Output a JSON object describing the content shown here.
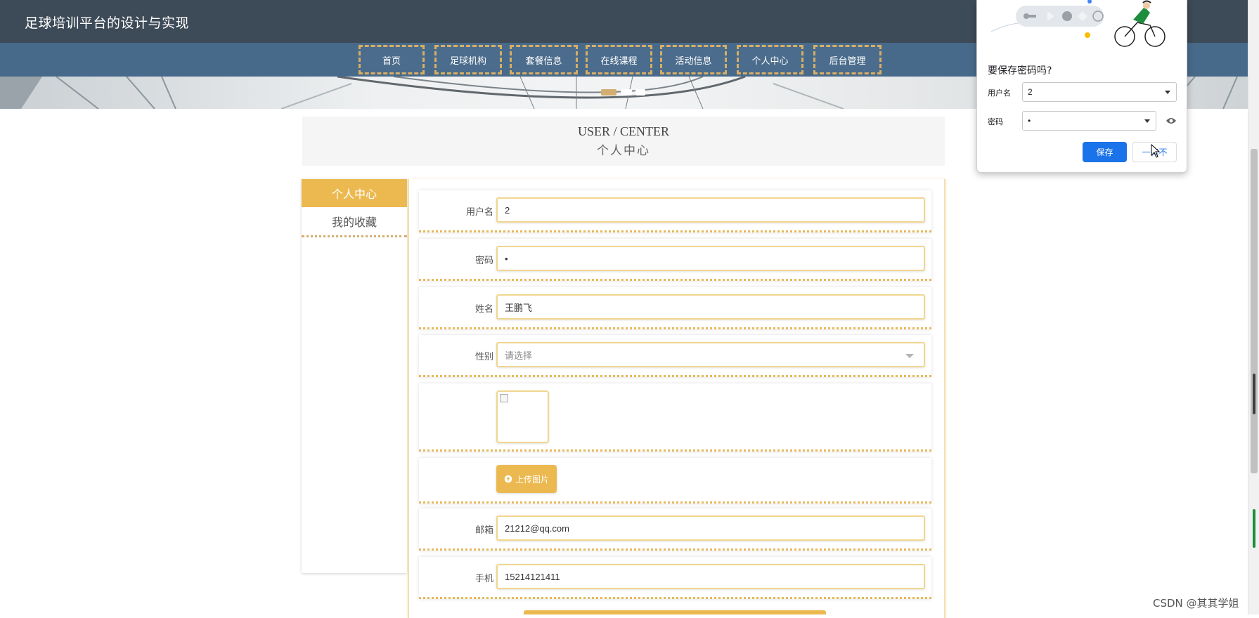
{
  "site": {
    "title": "足球培训平台的设计与实现"
  },
  "nav": {
    "items": [
      {
        "label": "首页"
      },
      {
        "label": "足球机构"
      },
      {
        "label": "套餐信息"
      },
      {
        "label": "在线课程"
      },
      {
        "label": "活动信息"
      },
      {
        "label": "个人中心"
      },
      {
        "label": "后台管理"
      }
    ]
  },
  "carousel": {
    "slide_count": 3,
    "active_index": 0
  },
  "user_center": {
    "title_en": "USER / CENTER",
    "title_cn": "个人中心"
  },
  "sidebar": {
    "items": [
      {
        "label": "个人中心",
        "active": true
      },
      {
        "label": "我的收藏",
        "active": false
      }
    ]
  },
  "form": {
    "username": {
      "label": "用户名",
      "value": "2"
    },
    "password": {
      "label": "密码",
      "value": "•"
    },
    "name": {
      "label": "姓名",
      "value": "王鹏飞"
    },
    "gender": {
      "label": "性别",
      "placeholder": "请选择"
    },
    "upload_label": "上传图片",
    "email": {
      "label": "邮箱",
      "value": "21212@qq.com"
    },
    "phone": {
      "label": "手机",
      "value": "15214121411"
    }
  },
  "password_popup": {
    "title": "要保存密码吗?",
    "username_label": "用户名",
    "username_value": "2",
    "password_label": "密码",
    "password_value": "•",
    "save_label": "保存",
    "never_label": "一律不"
  },
  "watermark": "CSDN @其其学姐",
  "colors": {
    "topbar": "#3d4a57",
    "navbar": "#486a8a",
    "accent": "#ecb950",
    "nav_border": "#d8ae63",
    "popup_blue": "#1a73e8"
  }
}
